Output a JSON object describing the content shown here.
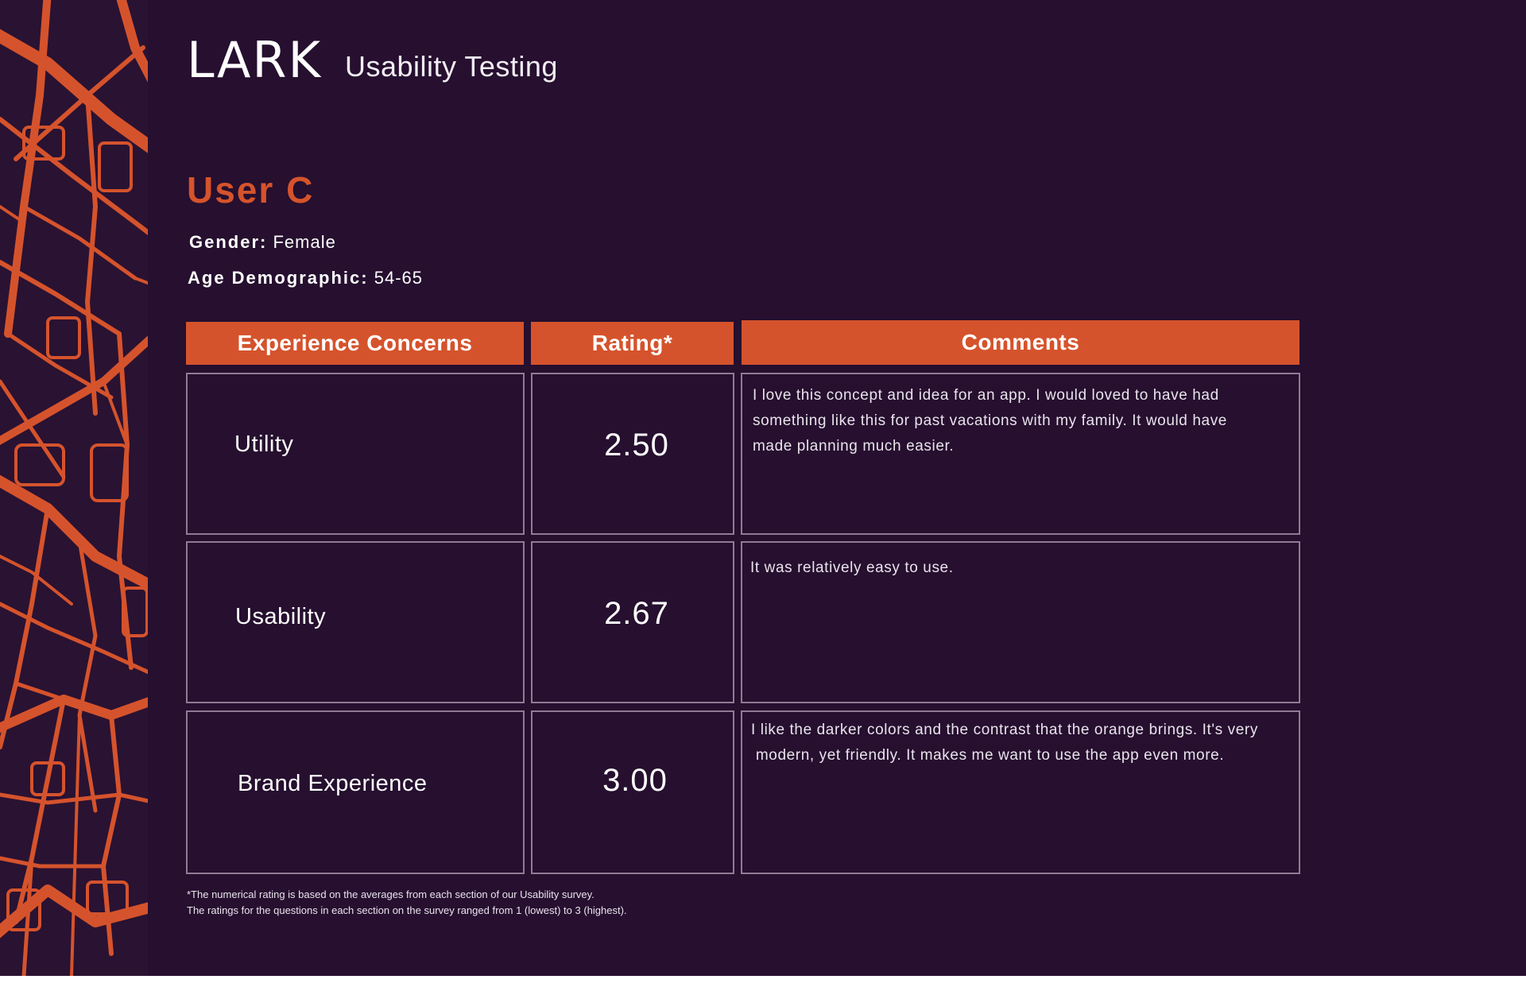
{
  "brand": {
    "logo_text": "LARK",
    "subtitle": "Usability Testing"
  },
  "user": {
    "title": "User C",
    "gender_label": "Gender:",
    "gender_value": "Female",
    "age_label": "Age Demographic:",
    "age_value": "54-65"
  },
  "table": {
    "headers": [
      "Experience Concerns",
      "Rating*",
      "Comments"
    ],
    "rows": [
      {
        "concern": "Utility",
        "rating": "2.50",
        "comment_lines": [
          "I love this concept and idea for an app. I would loved to have had",
          "something like this for past vacations with my family. It would have",
          "made planning much easier."
        ]
      },
      {
        "concern": "Usability",
        "rating": "2.67",
        "comment_lines": [
          "It was relatively easy to use."
        ]
      },
      {
        "concern": "Brand Experience",
        "rating": "3.00",
        "comment_lines": [
          "I like the darker colors and the contrast that the orange brings. It's very",
          " modern, yet friendly. It makes me want to use the app even more."
        ]
      }
    ]
  },
  "footnote": {
    "line1": "*The numerical rating is based on the averages from each section of our Usability survey.",
    "line2": "The ratings for the questions in each section on the survey ranged from 1 (lowest) to 3 (highest)."
  },
  "colors": {
    "background": "#260f2f",
    "accent": "#d5532c",
    "cell_border": "#8f7b95",
    "text": "#ffffff"
  }
}
